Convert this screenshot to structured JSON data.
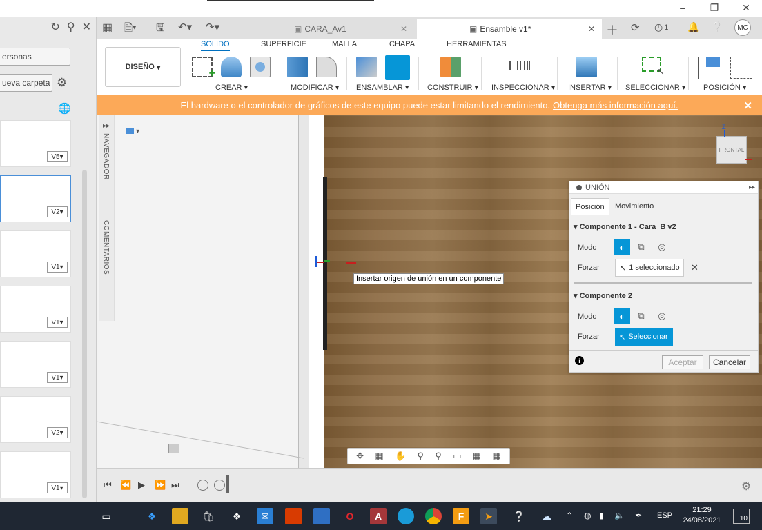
{
  "left_panel": {
    "personas_label": "ersonas",
    "new_folder_label": "ueva carpeta",
    "versions": [
      "V5",
      "V2",
      "V1",
      "V1",
      "V1",
      "V2",
      "V1"
    ]
  },
  "tabs": [
    {
      "label": "CARA_Av1",
      "active": false
    },
    {
      "label": "Ensamble v1*",
      "active": true
    }
  ],
  "header": {
    "notif_count": "1",
    "avatar": "MC"
  },
  "ribbon": {
    "design": "DISEÑO",
    "tabs": [
      "SOLIDO",
      "SUPERFICIE",
      "MALLA",
      "CHAPA",
      "HERRAMIENTAS"
    ],
    "groups": [
      "CREAR",
      "MODIFICAR",
      "ENSAMBLAR",
      "CONSTRUIR",
      "INSPECCIONAR",
      "INSERTAR",
      "SELECCIONAR",
      "POSICIÓN"
    ]
  },
  "warning": {
    "text": "El hardware o el controlador de gráficos de este equipo puede estar limitando el rendimiento.",
    "link": "Obtenga más información aquí."
  },
  "viewport": {
    "navegador": "NAVEGADOR",
    "comentarios": "COMENTARIOS",
    "tooltip": "Insertar origen de unión en un componente",
    "viewcube_face": "FRONTAL",
    "axis_label": "Z"
  },
  "union": {
    "title": "UNIÓN",
    "tabs": [
      "Posición",
      "Movimiento"
    ],
    "comp1": "Componente 1 - Cara_B v2",
    "comp2": "Componente 2",
    "modo": "Modo",
    "forzar": "Forzar",
    "selected": "1 seleccionado",
    "select_btn": "Seleccionar",
    "accept": "Aceptar",
    "cancel": "Cancelar"
  },
  "taskbar": {
    "lang": "ESP",
    "time": "21:29",
    "date": "24/08/2021",
    "notif": "10"
  },
  "colors": {
    "accent": "#0696d7",
    "warning_bg": "#fca958",
    "taskbar_bg": "#1f2733"
  }
}
